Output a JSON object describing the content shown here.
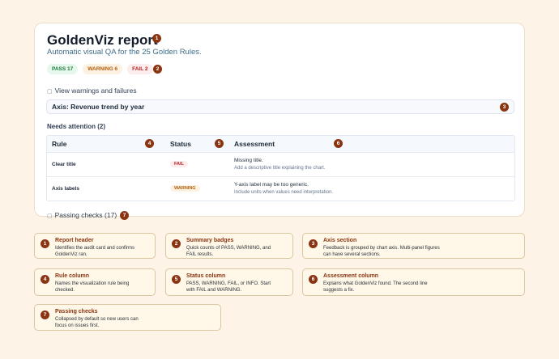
{
  "report": {
    "title": "GoldenViz report",
    "subtitle": "Automatic visual QA for the 25 Golden Rules."
  },
  "badges": {
    "pass": "PASS 17",
    "warning": "WARNING 6",
    "fail": "FAIL 2"
  },
  "disclosures": {
    "toggle_icon": "▢",
    "warnings_label": "View warnings and failures",
    "passing_label": "Passing checks (17)"
  },
  "axis_section": {
    "label": "Axis: Revenue trend by year"
  },
  "needs_attention": "Needs attention (2)",
  "table": {
    "headers": [
      "Rule",
      "Status",
      "Assessment"
    ],
    "rows": [
      {
        "rule": "Clear title",
        "status": "FAIL",
        "assessment": "Missing title.",
        "suggestion": "Add a descriptive title explaining the chart."
      },
      {
        "rule": "Axis labels",
        "status": "WARNING",
        "assessment": "Y-axis label may be too generic.",
        "suggestion": "Include units when values need interpretation."
      }
    ]
  },
  "markers": [
    "1",
    "2",
    "3",
    "4",
    "5",
    "6",
    "7"
  ],
  "callouts": [
    {
      "num": "1",
      "title": "Report header",
      "body": "Identifies the audit card and confirms GoldenViz ran."
    },
    {
      "num": "2",
      "title": "Summary badges",
      "body": "Quick counts of PASS, WARNING, and FAIL results."
    },
    {
      "num": "3",
      "title": "Axis section",
      "body": "Feedback is grouped by chart axis. Multi-panel figures can have several sections."
    },
    {
      "num": "4",
      "title": "Rule column",
      "body": "Names the visualization rule being checked."
    },
    {
      "num": "5",
      "title": "Status column",
      "body": "PASS, WARNING, FAIL, or INFO. Start with FAIL and WARNING."
    },
    {
      "num": "6",
      "title": "Assessment column",
      "body": "Explains what GoldenViz found. The second line suggests a fix."
    },
    {
      "num": "7",
      "title": "Passing checks",
      "body": "Collapsed by default so new users can focus on issues first."
    }
  ],
  "colors": {
    "background": "#fdf3e6",
    "marker": "#8a3411",
    "pass": "#1f7a3e",
    "warning": "#b06010",
    "fail": "#b42323"
  }
}
